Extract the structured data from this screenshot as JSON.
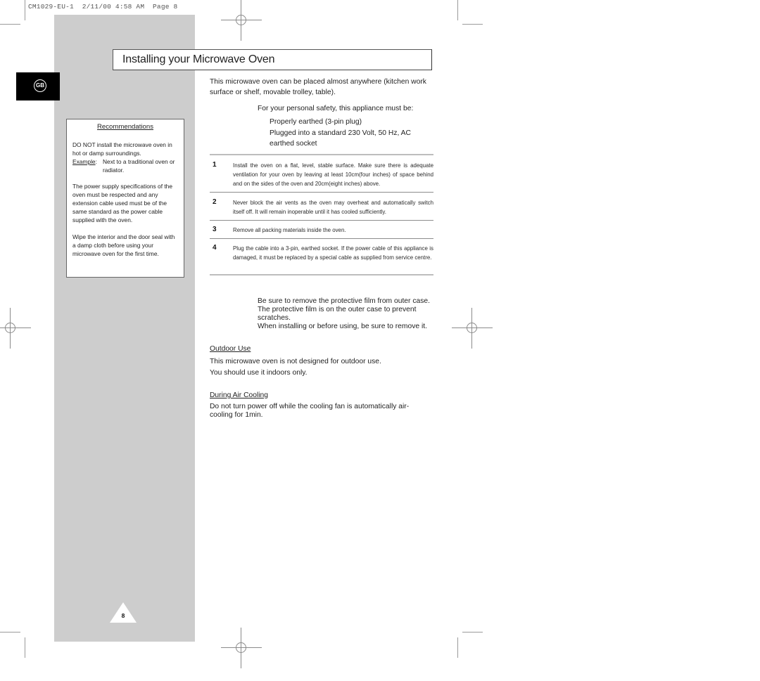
{
  "print_header": "CM1029-EU-1  2/11/00 4:58 AM  Page 8",
  "language_tab": "GB",
  "title": "Installing your Microwave Oven",
  "recommendations": {
    "heading": "Recommendations",
    "p1": "DO NOT install the microwave oven in hot or damp surroundings.",
    "example_label": "Example",
    "example_text": "Next to a traditional oven or radiator.",
    "p2": "The power supply specifications of the oven must be respected and any extension cable used must be of the same standard as the power cable supplied with the oven.",
    "p3": "Wipe the interior and the door seal with a damp cloth before using your microwave oven for the first time."
  },
  "intro": "This microwave oven can be placed almost anywhere (kitchen work surface or shelf, movable trolley, table).",
  "safety": {
    "lead": "For your personal safety, this appliance must be:",
    "items": [
      "Properly earthed (3-pin plug)",
      "Plugged into a standard 230 Volt, 50 Hz, AC earthed socket"
    ]
  },
  "steps": [
    {
      "num": "1",
      "text": "Install the oven on a flat, level, stable surface. Make sure there is adequate ventilation for your oven by leaving at least 10cm(four inches) of space behind and on the sides of the oven and 20cm(eight inches) above."
    },
    {
      "num": "2",
      "text": "Never block the air vents as the oven may overheat and automatically switch itself off. It will remain inoperable until it has cooled sufficiently."
    },
    {
      "num": "3",
      "text": "Remove all packing materials inside the oven."
    },
    {
      "num": "4",
      "text": "Plug the cable into a 3-pin, earthed socket. If the power cable of this appliance is damaged, it must be replaced by a special cable as supplied from service centre."
    }
  ],
  "film_note": {
    "line1": "Be sure to remove the protective film from outer case.",
    "line2": "The protective film is on the outer case to prevent scratches.",
    "line3": "When installing or before using, be sure to remove it."
  },
  "outdoor": {
    "heading": "Outdoor Use",
    "line1": "This microwave oven is not designed for outdoor use.",
    "line2": "You should use it indoors only."
  },
  "air_cooling": {
    "heading": "During Air Cooling",
    "text": "Do not turn power off while the cooling fan is automatically air-cooling for 1min."
  },
  "page_number": "8"
}
